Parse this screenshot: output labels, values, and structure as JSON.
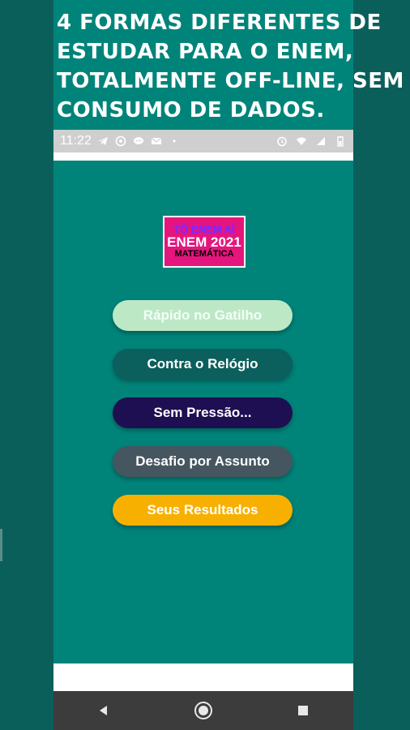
{
  "headline": "4 FORMAS DIFERENTES DE ESTUDAR PARA O ENEM, TOTALMENTE OFF-LINE, SEM CONSUMO DE DADOS.",
  "status_bar": {
    "time": "11:22",
    "left_icons": [
      "telegram-icon",
      "whatsapp-icon",
      "chat-icon",
      "mail-icon",
      "dot-icon"
    ],
    "right_icons": [
      "alarm-icon",
      "wifi-icon",
      "signal-icon",
      "battery-icon"
    ]
  },
  "logo": {
    "line1": "TÔ ENEM AÍ",
    "line2": "ENEM 2021",
    "line3": "MATEMÁTICA"
  },
  "buttons": [
    {
      "label": "Rápido no Gatilho",
      "color": "#bde8c6",
      "text_color": "#f2fff6"
    },
    {
      "label": "Contra o Relógio",
      "color": "#0b5f5c",
      "text_color": "#ffffff"
    },
    {
      "label": "Sem Pressão...",
      "color": "#1e0f52",
      "text_color": "#ffffff"
    },
    {
      "label": "Desafio por Assunto",
      "color": "#455660",
      "text_color": "#ffffff"
    },
    {
      "label": "Seus Resultados",
      "color": "#f8b000",
      "text_color": "#ffffff"
    }
  ],
  "nav_bar": [
    "back-icon",
    "home-icon",
    "recents-icon"
  ],
  "colors": {
    "background": "#0b5f5a",
    "panel": "#00847a",
    "logo_bg": "#e4167e"
  }
}
